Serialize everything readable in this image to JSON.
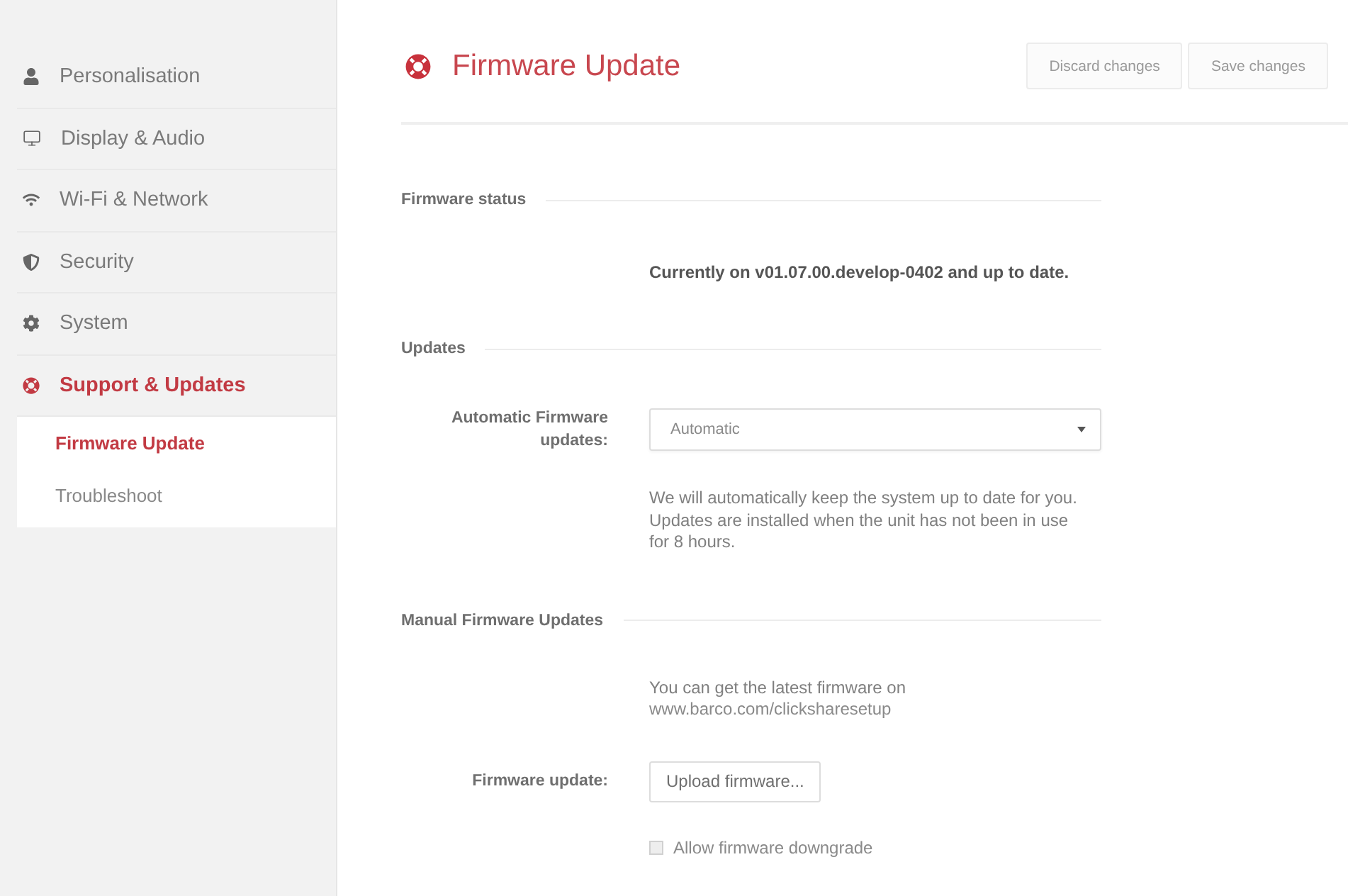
{
  "sidebar": {
    "items": [
      {
        "label": "Personalisation",
        "selected": false
      },
      {
        "label": "Display & Audio",
        "selected": false
      },
      {
        "label": "Wi-Fi & Network",
        "selected": false
      },
      {
        "label": "Security",
        "selected": false
      },
      {
        "label": "System",
        "selected": false
      },
      {
        "label": "Support & Updates",
        "selected": true,
        "children": [
          {
            "label": "Firmware Update",
            "selected": true
          },
          {
            "label": "Troubleshoot",
            "selected": false
          }
        ]
      }
    ]
  },
  "header": {
    "title": "Firmware Update",
    "buttons": [
      "Discard changes",
      "Save changes"
    ]
  },
  "sections": [
    {
      "title": "Firmware status",
      "rows": [
        {
          "kind": "status",
          "text": "Currently on v01.07.00.develop-0402 and up to date."
        }
      ]
    },
    {
      "title": "Updates",
      "rows": [
        {
          "kind": "select",
          "label": "Automatic Firmware updates:",
          "value": "Automatic"
        },
        {
          "kind": "help",
          "text": "We will automatically keep the system up to date for you. Updates are installed when the unit has not been in use for 8 hours."
        }
      ]
    },
    {
      "title": "Manual Firmware Updates",
      "rows": [
        {
          "kind": "info",
          "text": "You can get the latest firmware on",
          "link": "www.barco.com/clicksharesetup"
        },
        {
          "kind": "upload",
          "label": "Firmware update:",
          "button": "Upload firmware..."
        },
        {
          "kind": "checkbox",
          "label": "Allow firmware downgrade",
          "checked": false
        }
      ]
    }
  ]
}
